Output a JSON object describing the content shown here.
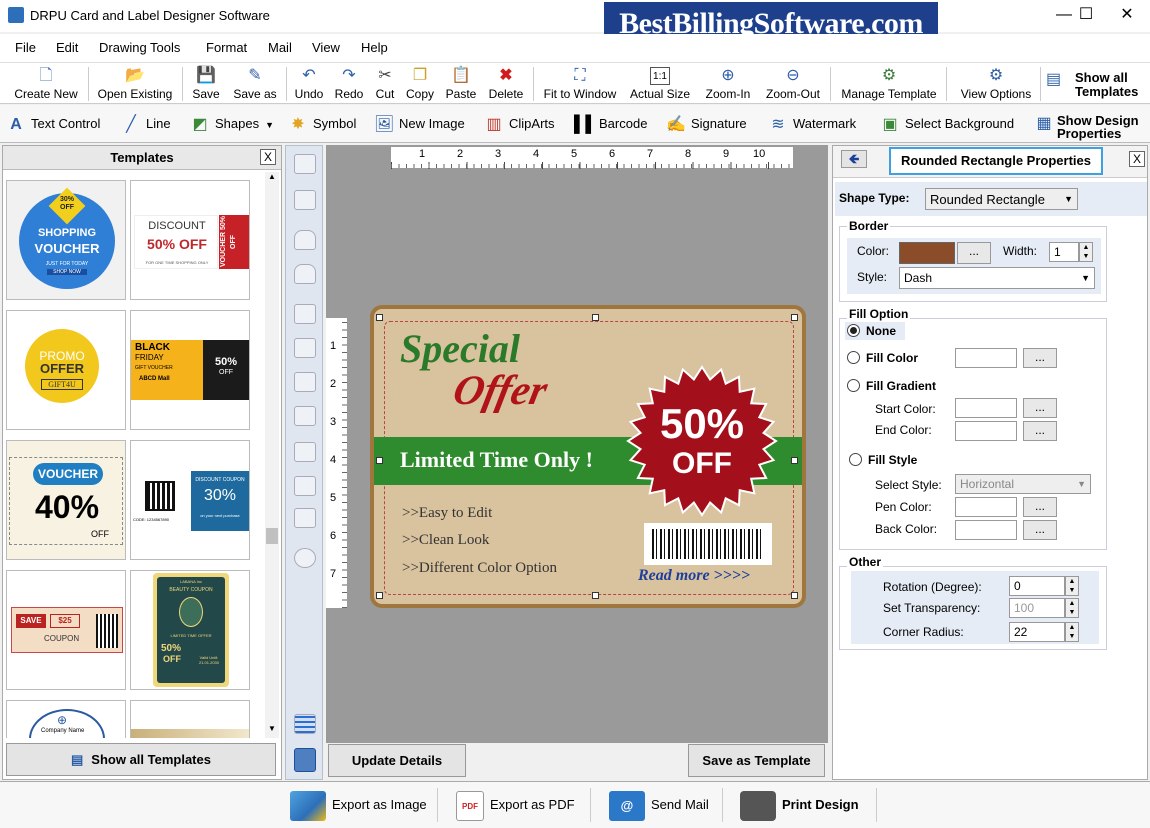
{
  "window": {
    "title": "DRPU Card and Label Designer Software",
    "brand": "BestBillingSoftware.com",
    "minimize": "—",
    "maximize": "☐",
    "close": "✕"
  },
  "menu": [
    "File",
    "Edit",
    "Drawing Tools",
    "Format",
    "Mail",
    "View",
    "Help"
  ],
  "toolbar": {
    "create_new": "Create New",
    "open_existing": "Open Existing",
    "save": "Save",
    "save_as": "Save as",
    "undo": "Undo",
    "redo": "Redo",
    "cut": "Cut",
    "copy": "Copy",
    "paste": "Paste",
    "delete": "Delete",
    "fit_to_window": "Fit to Window",
    "actual_size": "Actual Size",
    "zoom_in": "Zoom-In",
    "zoom_out": "Zoom-Out",
    "manage_template": "Manage Template",
    "view_options": "View Options",
    "show_all_line1": "Show all",
    "show_all_line2": "Templates"
  },
  "drawing_tools": {
    "text_control": "Text Control",
    "line": "Line",
    "shapes": "Shapes",
    "symbol": "Symbol",
    "new_image": "New Image",
    "clipart": "ClipArts",
    "barcode": "Barcode",
    "signature": "Signature",
    "watermark": "Watermark",
    "select_background": "Select Background",
    "show_design_line1": "Show Design",
    "show_design_line2": "Properties"
  },
  "templates_panel": {
    "title": "Templates",
    "close": "X",
    "show_all": "Show all Templates"
  },
  "thumbs": {
    "t1": {
      "badge_top": "30%",
      "badge_bottom": "OFF",
      "line1": "SHOPPING",
      "line2": "VOUCHER",
      "line3": "JUST FOR TODAY",
      "line4": "SHOP NOW"
    },
    "t2": {
      "line1": "DISCOUNT",
      "line2": "50% OFF",
      "side1": "VOUCHER",
      "side2": "50% OFF",
      "small": "FOR ONE TIME SHOPPING ONLY"
    },
    "t3": {
      "line1": "PROMO",
      "line2": "OFFER",
      "line3": "GIFT4U"
    },
    "t4": {
      "line1": "BLACK",
      "line2": "FRIDAY",
      "line3": "GIFT VOUCHER",
      "line4": "ABCD Mall",
      "price": "50%",
      "pricesub": "OFF"
    },
    "t5": {
      "line1": "VOUCHER",
      "line2": "40%",
      "line3": "OFF"
    },
    "t6": {
      "line1": "DISCOUNT COUPON",
      "line2": "30%",
      "code": "CODE: 1234567890",
      "sub": "on your next purchase"
    },
    "t7": {
      "line1": "SAVE",
      "line2": "$25",
      "line3": "COUPON"
    },
    "t8": {
      "line1": "LABANA Inc",
      "line2": "BEAUTY COUPON",
      "line3": "LIMITED TIME OFFER",
      "line4": "50%",
      "line5": "OFF",
      "line6": "Valid Until: 21.01.2030"
    },
    "t9": {
      "line1": "Company Name"
    }
  },
  "card": {
    "special": "Special",
    "offer": "Offer",
    "banner": "Limited Time Only !",
    "pct": "50%",
    "off": "OFF",
    "bullet1": ">>Easy to Edit",
    "bullet2": ">>Clean Look",
    "bullet3": ">>Different Color Option",
    "readmore": "Read more >>>>"
  },
  "ruler": {
    "top": [
      "1",
      "2",
      "3",
      "4",
      "5",
      "6",
      "7",
      "8",
      "9",
      "10"
    ],
    "left": [
      "1",
      "2",
      "3",
      "4",
      "5",
      "6",
      "7"
    ]
  },
  "canvas_buttons": {
    "update": "Update Details",
    "save_template": "Save as Template"
  },
  "props": {
    "title": "Rounded Rectangle Properties",
    "close": "X",
    "back": "🡸",
    "shape_type_label": "Shape Type:",
    "shape_type_value": "Rounded Rectangle",
    "border_label": "Border",
    "color_label": "Color:",
    "color_value": "#8b4c2a",
    "dots": "...",
    "width_label": "Width:",
    "width_value": "1",
    "style_label": "Style:",
    "style_value": "Dash",
    "fill_label": "Fill Option",
    "none": "None",
    "fill_color": "Fill Color",
    "fill_gradient": "Fill Gradient",
    "start_color": "Start Color:",
    "end_color": "End Color:",
    "fill_style": "Fill Style",
    "select_style": "Select Style:",
    "select_style_value": "Horizontal",
    "pen_color": "Pen Color:",
    "back_color": "Back Color:",
    "other_label": "Other",
    "rotation_label": "Rotation (Degree):",
    "rotation_value": "0",
    "transparency_label": "Set Transparency:",
    "transparency_value": "100",
    "corner_label": "Corner Radius:",
    "corner_value": "22"
  },
  "bottom": {
    "export_image": "Export as Image",
    "export_pdf": "Export as PDF",
    "send_mail": "Send Mail",
    "print_design": "Print Design"
  },
  "colors": {
    "accent": "#1d3f8c",
    "card_bg": "#d9c29e",
    "green_banner": "#2e8b2e",
    "seal": "#a30f1a",
    "text_red": "#b01419"
  }
}
